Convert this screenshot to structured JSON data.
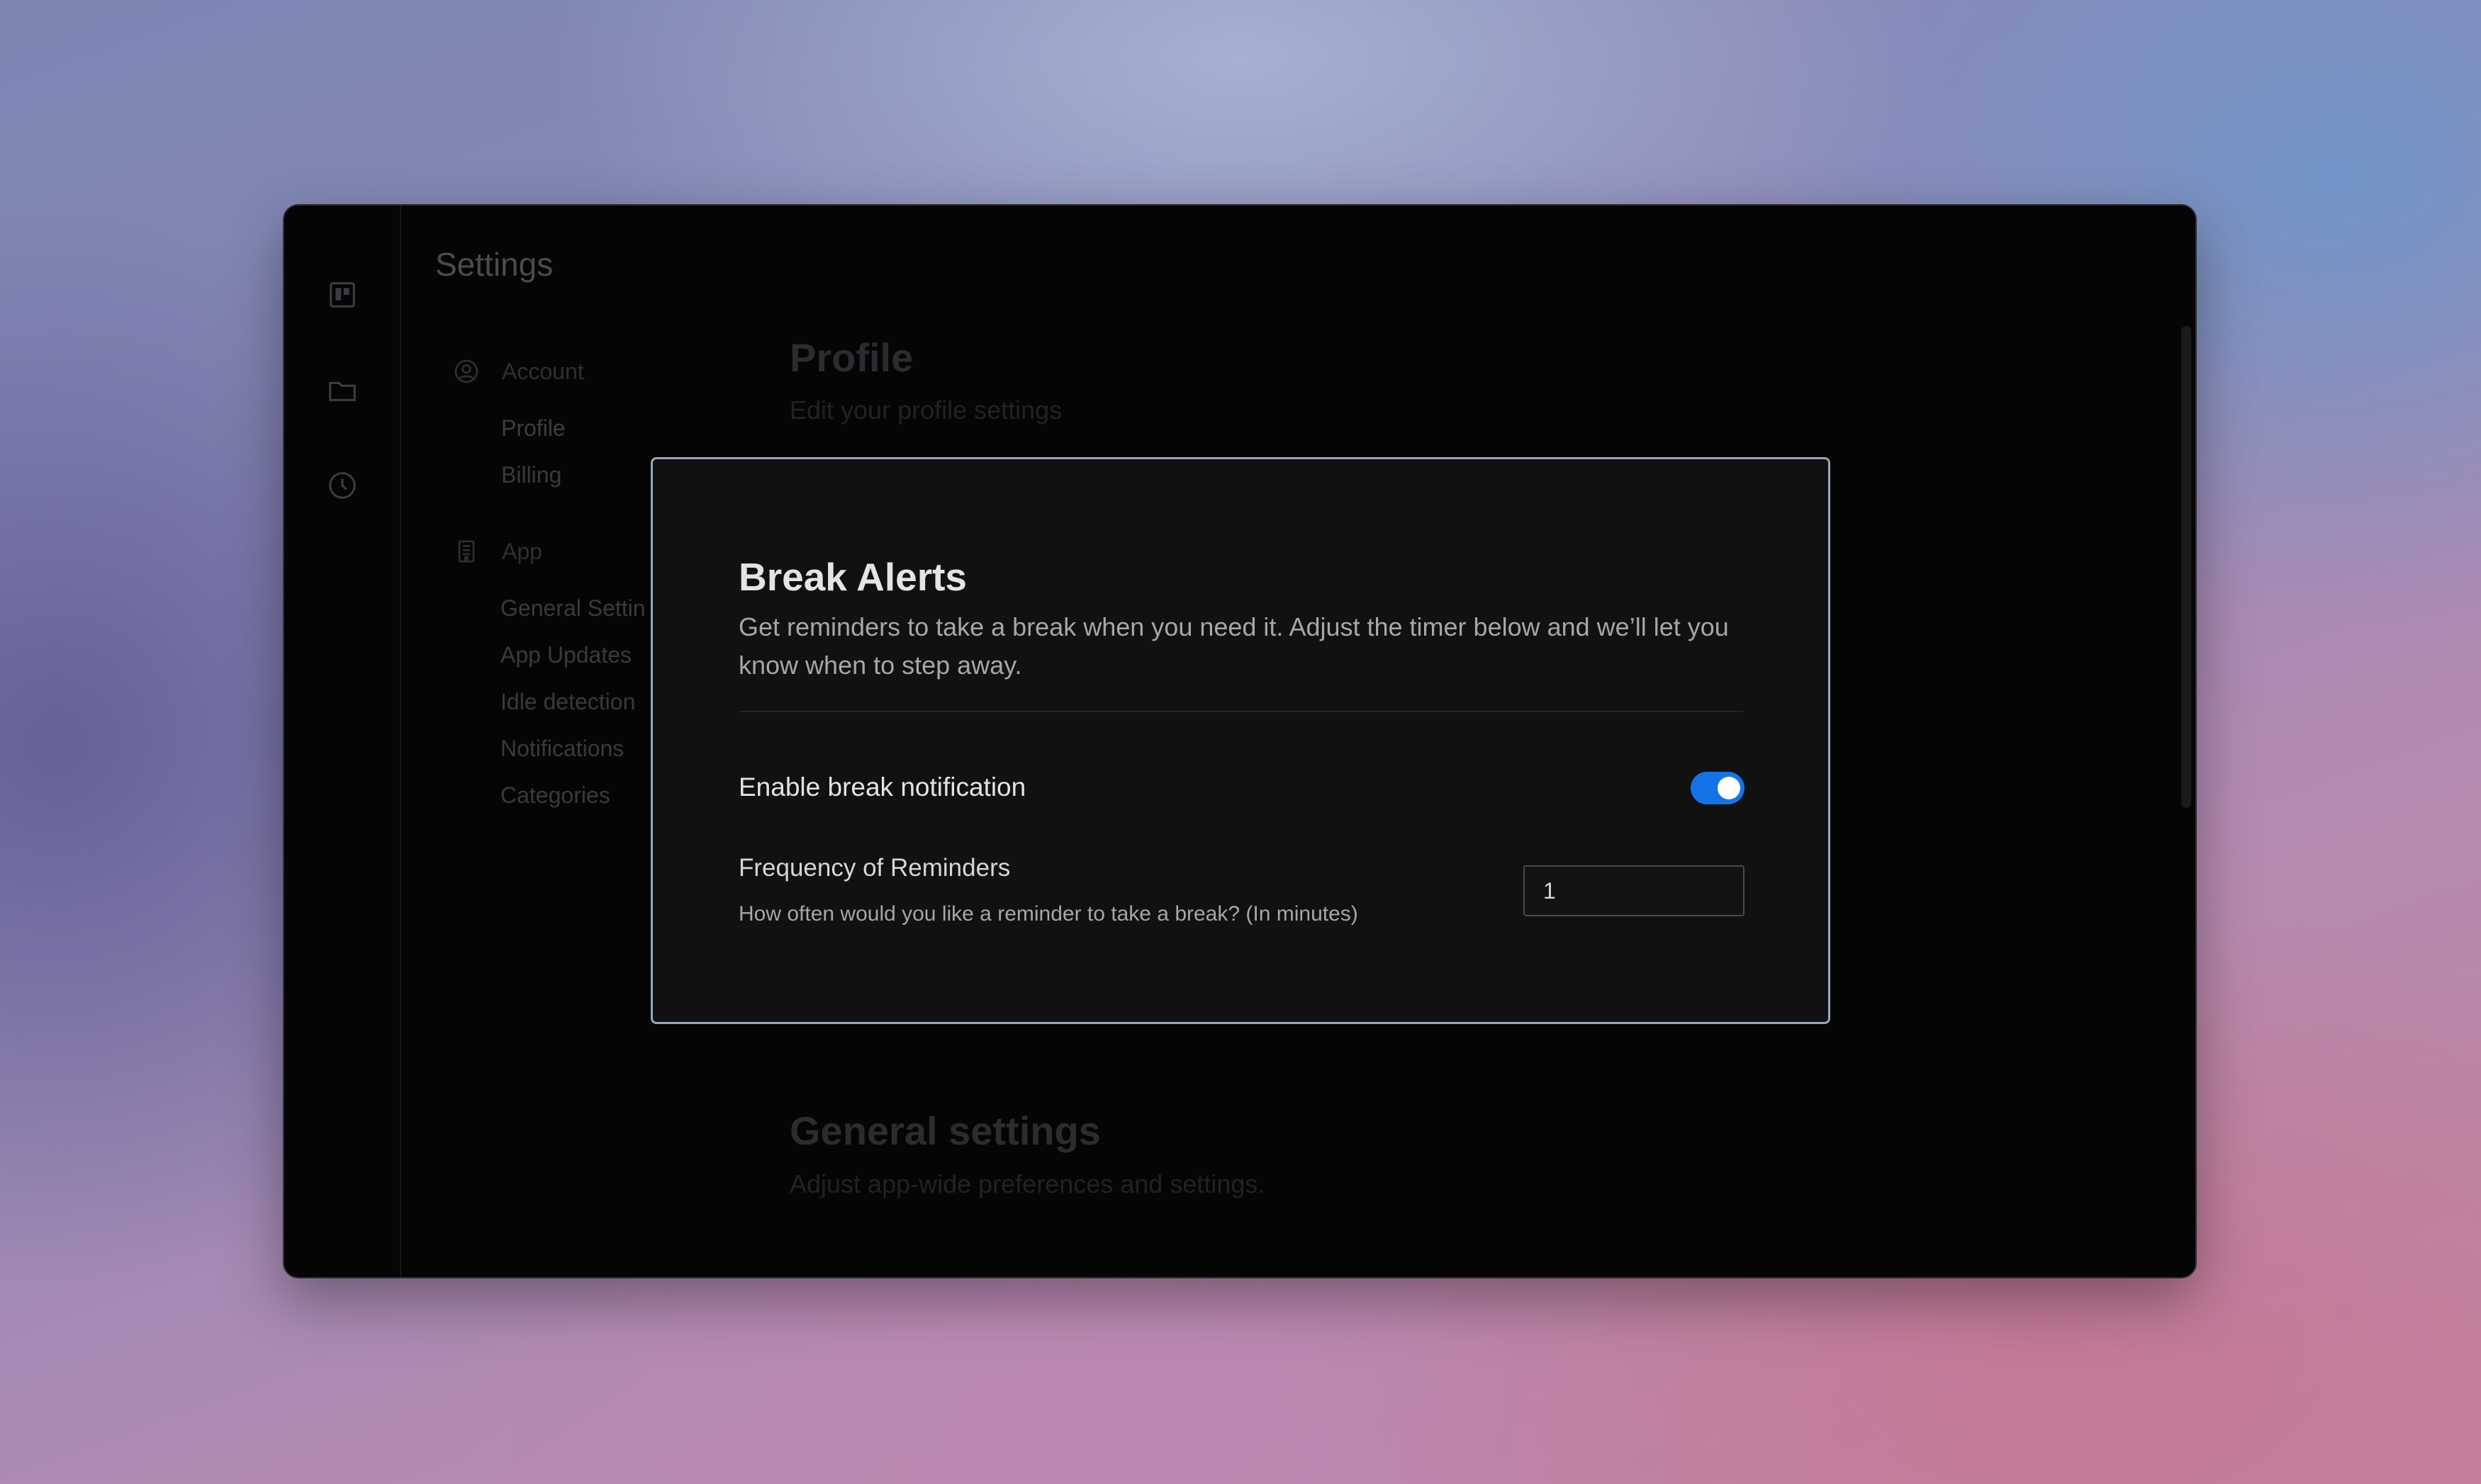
{
  "window": {
    "title": "Settings"
  },
  "rail": {
    "items": [
      {
        "icon": "kanban-board-icon"
      },
      {
        "icon": "folder-icon"
      },
      {
        "icon": "clock-icon"
      }
    ]
  },
  "nav": {
    "account": {
      "label": "Account",
      "icon": "user-circle-icon",
      "items": [
        "Profile",
        "Billing"
      ]
    },
    "app": {
      "label": "App",
      "icon": "building-icon",
      "items": [
        "General Settin",
        "App Updates",
        "Idle detection",
        "Notifications",
        "Categories"
      ]
    }
  },
  "sections": {
    "profile": {
      "title": "Profile",
      "subtitle": "Edit your profile settings"
    },
    "general": {
      "title": "General settings",
      "subtitle": "Adjust app-wide preferences and settings."
    }
  },
  "modal": {
    "title": "Break Alerts",
    "description": "Get reminders to take a break when you need it. Adjust the timer below and we’ll let you know when to step away.",
    "enable": {
      "label": "Enable break notification",
      "enabled": true
    },
    "frequency": {
      "label": "Frequency of Reminders",
      "help": "How often would you like a reminder to take a break? (In minutes)",
      "value": "1"
    }
  },
  "colors": {
    "accent": "#1473e6",
    "modal_border": "#9aa6bb",
    "window_bg": "#050505",
    "modal_bg": "#111111"
  }
}
